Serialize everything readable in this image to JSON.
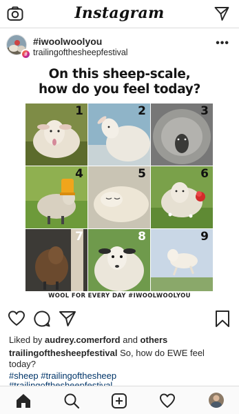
{
  "app": {
    "title": "Instagram"
  },
  "post": {
    "title": "#iwoolwoolyou",
    "subtitle": "trailingofthesheepfestival",
    "more_label": "•••"
  },
  "image": {
    "headline_line1": "On this sheep-scale,",
    "headline_line2": "how do you feel today?",
    "numbers": [
      "1",
      "2",
      "3",
      "4",
      "5",
      "6",
      "7",
      "8",
      "9"
    ],
    "footer": "WOOL FOR EVERY DAY #IWOOLWOOLYOU"
  },
  "likes": {
    "prefix": "Liked by ",
    "user": "audrey.comerford",
    "and": " and ",
    "others": "others"
  },
  "caption": {
    "user": "trailingofthesheepfestival",
    "text": " So, how do EWE feel today?"
  },
  "hashtags": {
    "line1": "#sheep #trailingofthesheep",
    "line2": "#trailingofthesheepfestival"
  },
  "icons": {
    "camera": "camera-icon",
    "send": "paper-plane-icon",
    "like": "heart-icon",
    "comment": "comment-bubble-icon",
    "share": "paper-plane-icon",
    "save": "bookmark-icon",
    "home": "home-icon",
    "search": "search-icon",
    "add": "plus-square-icon",
    "activity": "heart-icon"
  }
}
